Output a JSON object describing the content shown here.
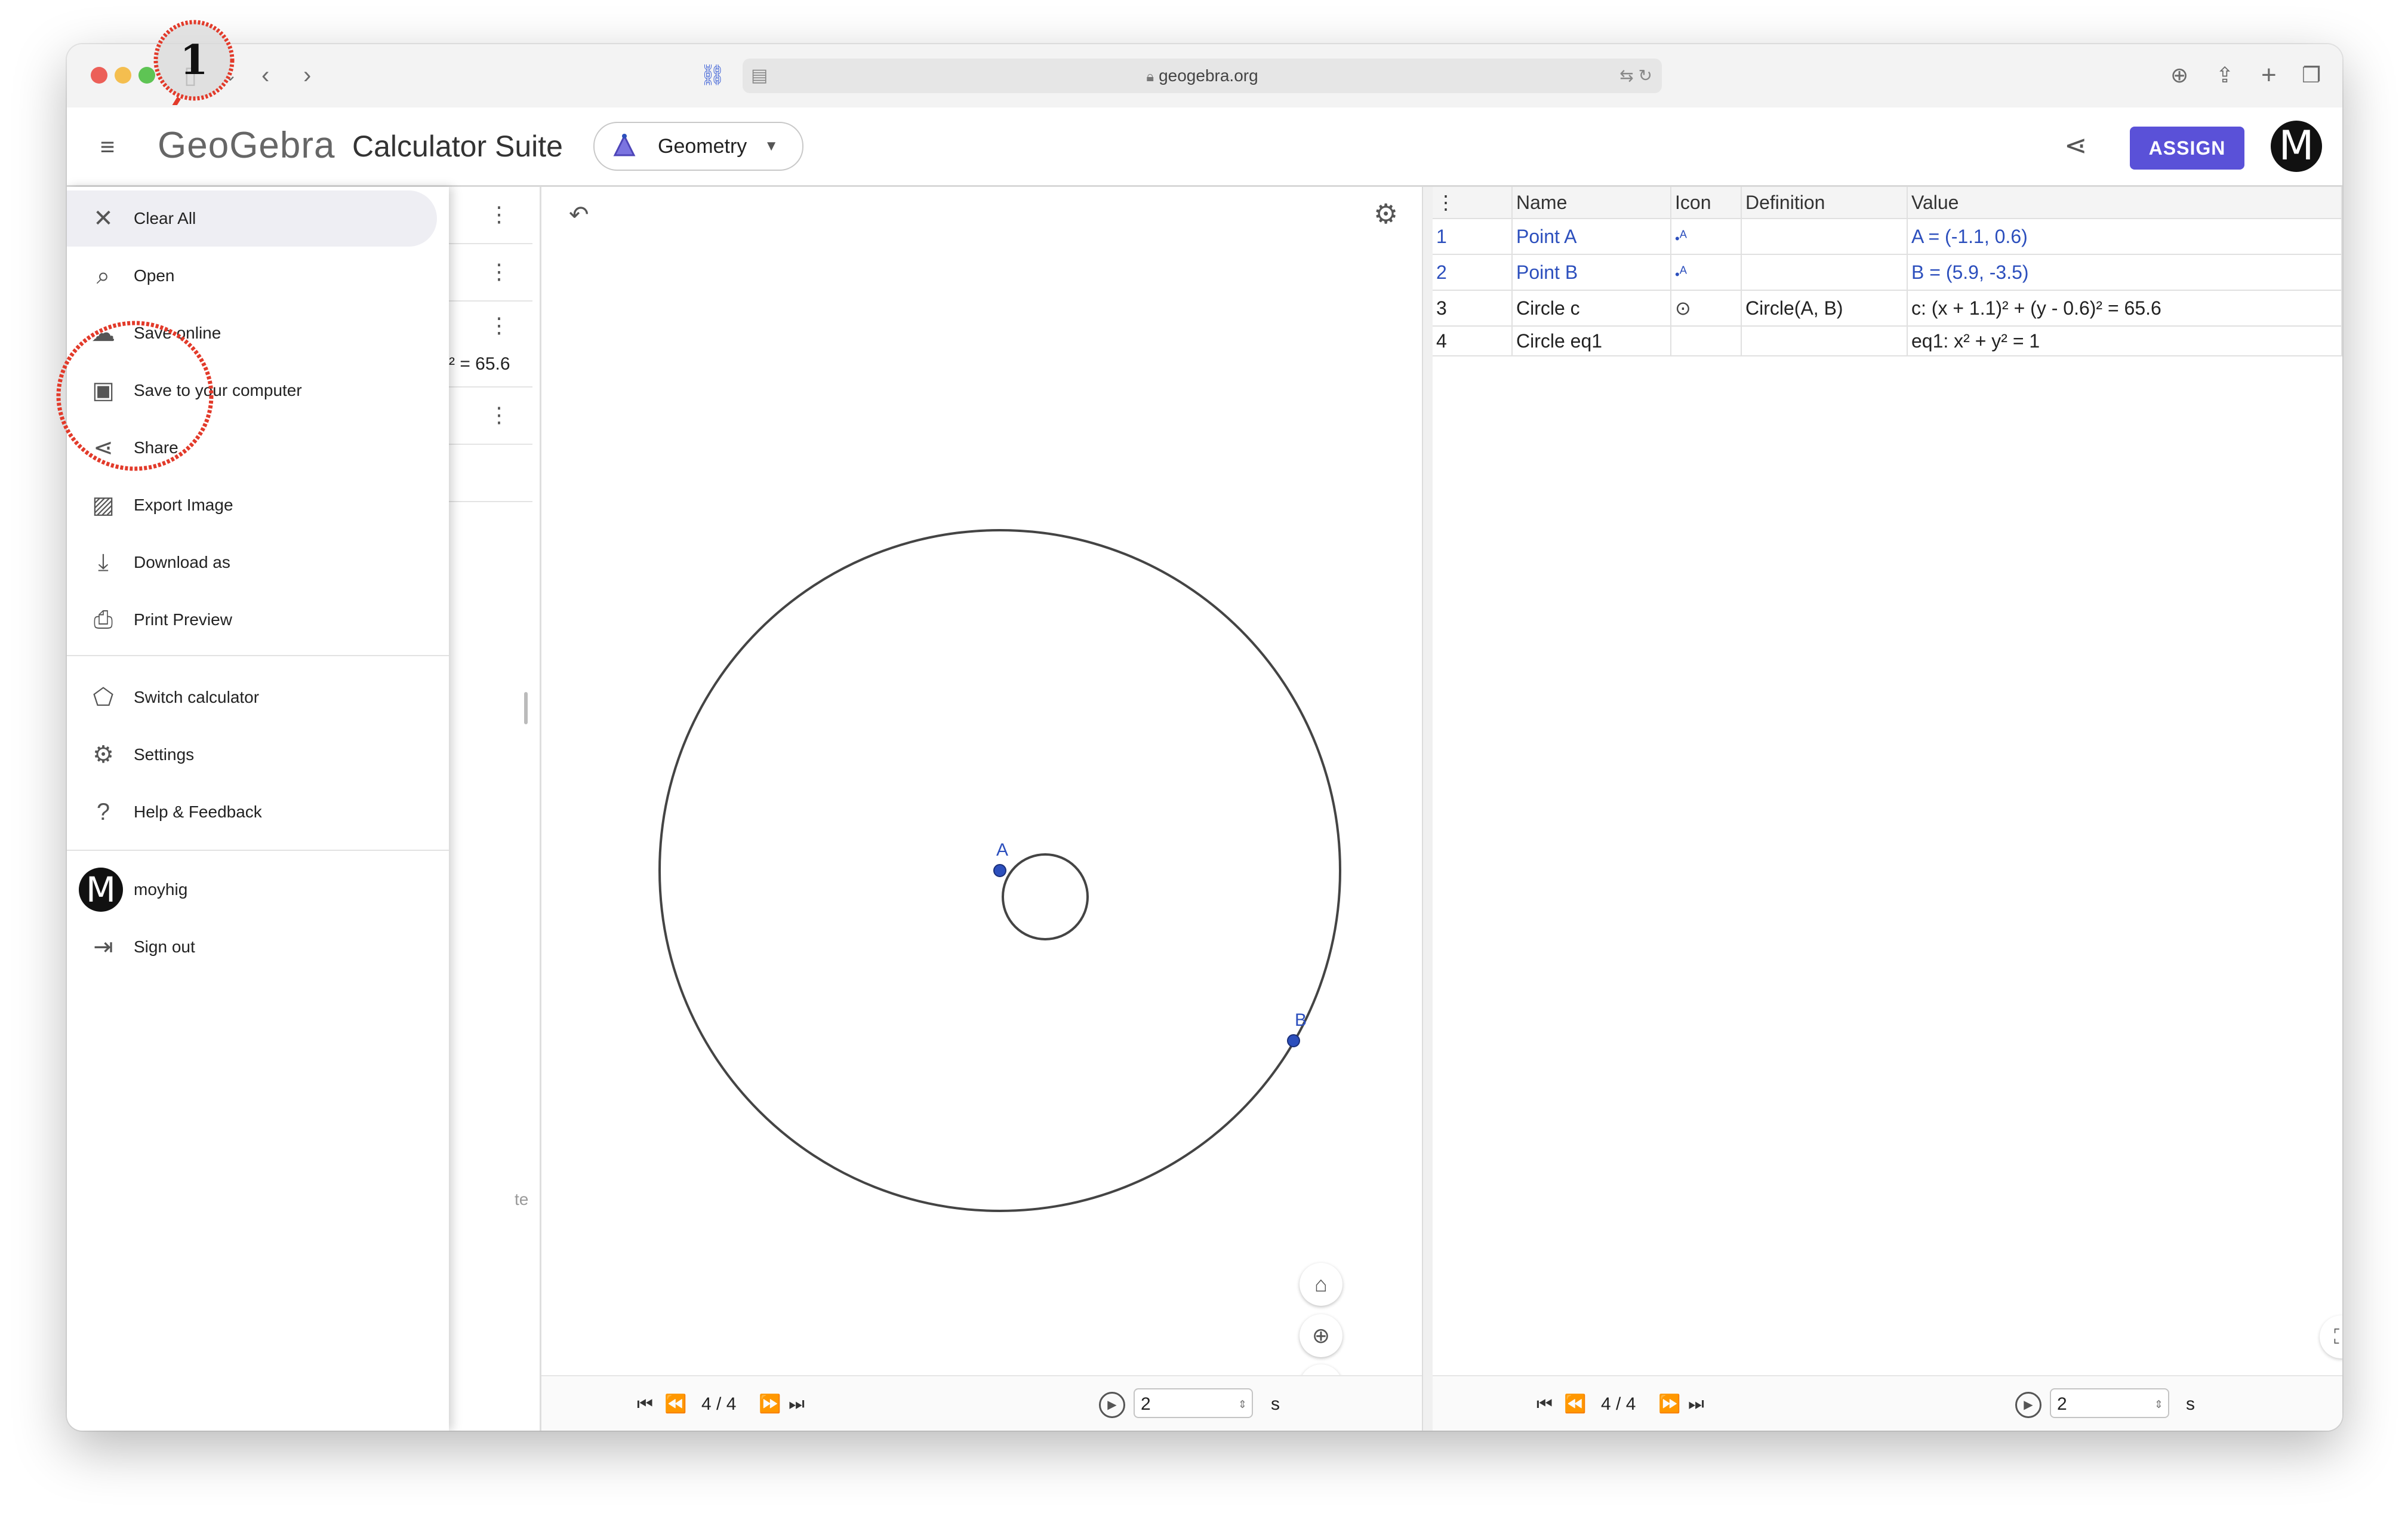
{
  "browser": {
    "url": "geogebra.org"
  },
  "header": {
    "logo": "GeoGebra",
    "suite_title": "Calculator Suite",
    "app_selector": "Geometry",
    "assign_label": "ASSIGN",
    "avatar_letter": "M"
  },
  "menu": {
    "items": [
      {
        "label": "Clear All",
        "icon": "close-icon"
      },
      {
        "label": "Open",
        "icon": "search-icon"
      },
      {
        "label": "Save online",
        "icon": "cloud-save-icon"
      },
      {
        "label": "Save to your computer",
        "icon": "save-icon"
      },
      {
        "label": "Share",
        "icon": "share-icon"
      },
      {
        "label": "Export Image",
        "icon": "image-icon"
      },
      {
        "label": "Download as",
        "icon": "download-icon"
      },
      {
        "label": "Print Preview",
        "icon": "print-icon"
      }
    ],
    "items2": [
      {
        "label": "Switch calculator",
        "icon": "switch-calculator-icon"
      },
      {
        "label": "Settings",
        "icon": "gear-icon"
      },
      {
        "label": "Help & Feedback",
        "icon": "help-icon"
      }
    ],
    "user": {
      "avatar_letter": "M",
      "name": "moyhig"
    },
    "sign_out": "Sign out"
  },
  "algebra": {
    "partial_value": "² = 65.6",
    "partial_footer": "te"
  },
  "graphics": {
    "point_a_label": "A",
    "point_b_label": "B",
    "step_display": "4 / 4",
    "speed_value": "2",
    "speed_unit": "s"
  },
  "protocol": {
    "columns": [
      "Name",
      "Icon",
      "Definition",
      "Value"
    ],
    "rows": [
      {
        "num": "1",
        "name": "Point A",
        "icon": "point-icon",
        "definition": "",
        "value": "A = (-1.1, 0.6)",
        "highlight": true
      },
      {
        "num": "2",
        "name": "Point B",
        "icon": "point-icon",
        "definition": "",
        "value": "B = (5.9, -3.5)",
        "highlight": true
      },
      {
        "num": "3",
        "name": "Circle c",
        "icon": "circle-icon",
        "definition": "Circle(A, B)",
        "value": "c: (x + 1.1)² + (y - 0.6)² = 65.6",
        "highlight": false
      },
      {
        "num": "4",
        "name": "Circle eq1",
        "icon": "",
        "definition": "",
        "value": "eq1: x² + y² = 1",
        "highlight": false
      }
    ],
    "step_display": "4 / 4",
    "speed_value": "2",
    "speed_unit": "s"
  },
  "annotation": {
    "step_number": "1"
  },
  "colors": {
    "accent": "#5a51d8",
    "point_blue": "#2c4fbd",
    "annotation_red": "#e23a2a"
  }
}
